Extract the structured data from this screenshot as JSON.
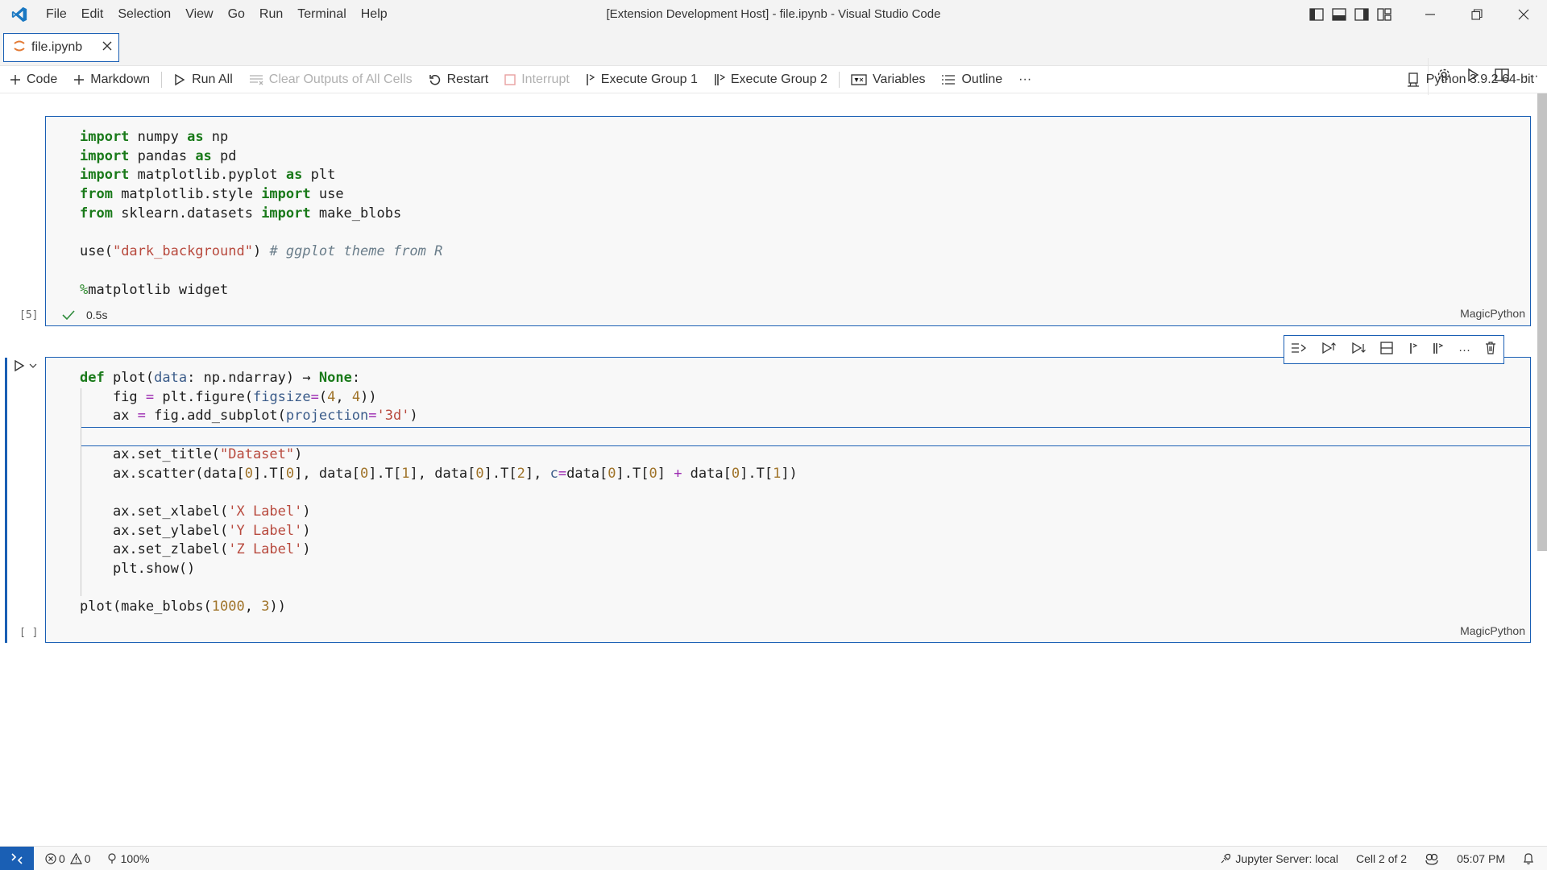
{
  "titlebar": {
    "title": "[Extension Development Host] - file.ipynb - Visual Studio Code",
    "menu": [
      "File",
      "Edit",
      "Selection",
      "View",
      "Go",
      "Run",
      "Terminal",
      "Help"
    ]
  },
  "tab": {
    "label": "file.ipynb"
  },
  "toolbar": {
    "code": "Code",
    "markdown": "Markdown",
    "run_all": "Run All",
    "clear_outputs": "Clear Outputs of All Cells",
    "restart": "Restart",
    "interrupt": "Interrupt",
    "exec_group_1": "Execute Group 1",
    "exec_group_2": "Execute Group 2",
    "variables": "Variables",
    "outline": "Outline",
    "more": "···",
    "kernel": "Python 3.9.2 64-bit"
  },
  "cells": [
    {
      "exec_count": "[5]",
      "status_time": "0.5s",
      "language": "MagicPython"
    },
    {
      "exec_count": "[ ]",
      "language": "MagicPython"
    }
  ],
  "statusbar": {
    "errors": "0",
    "warnings": "0",
    "zoom": "100%",
    "jupyter": "Jupyter Server: local",
    "cell_pos": "Cell 2 of 2",
    "time": "05:07 PM"
  },
  "colors": {
    "accent": "#1a5fb4",
    "keyword": "#1a7a1a",
    "string": "#b84a3e"
  }
}
